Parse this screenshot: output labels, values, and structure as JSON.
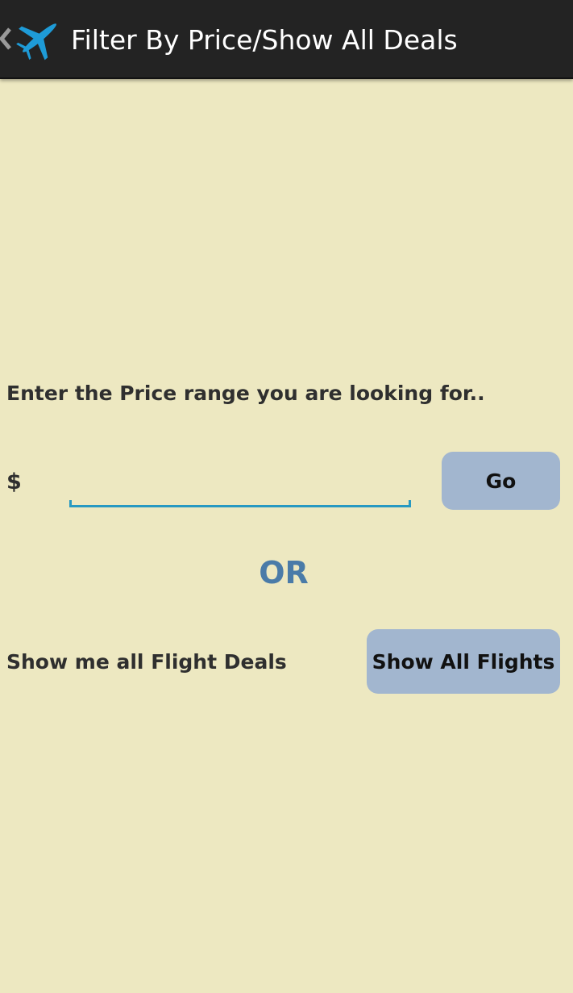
{
  "action_bar": {
    "title": "Filter By Price/Show All Deals",
    "up_icon": "chevron-left-icon",
    "app_icon": "airplane-icon",
    "background": "#232323",
    "icon_color": "#1e9bd7"
  },
  "price_filter": {
    "prompt": "Enter the Price range you are looking for..",
    "currency_symbol": "$",
    "input_value": "",
    "input_placeholder": "",
    "go_label": "Go",
    "underline_color": "#2799c2"
  },
  "divider": {
    "or_label": "OR",
    "color": "#4a7ba8"
  },
  "all_deals": {
    "label": "Show me all Flight Deals",
    "button_label": "Show All Flights"
  },
  "theme": {
    "page_background": "#ede8c1",
    "button_background": "#a2b6cf",
    "text_color": "#2f2f2f"
  }
}
